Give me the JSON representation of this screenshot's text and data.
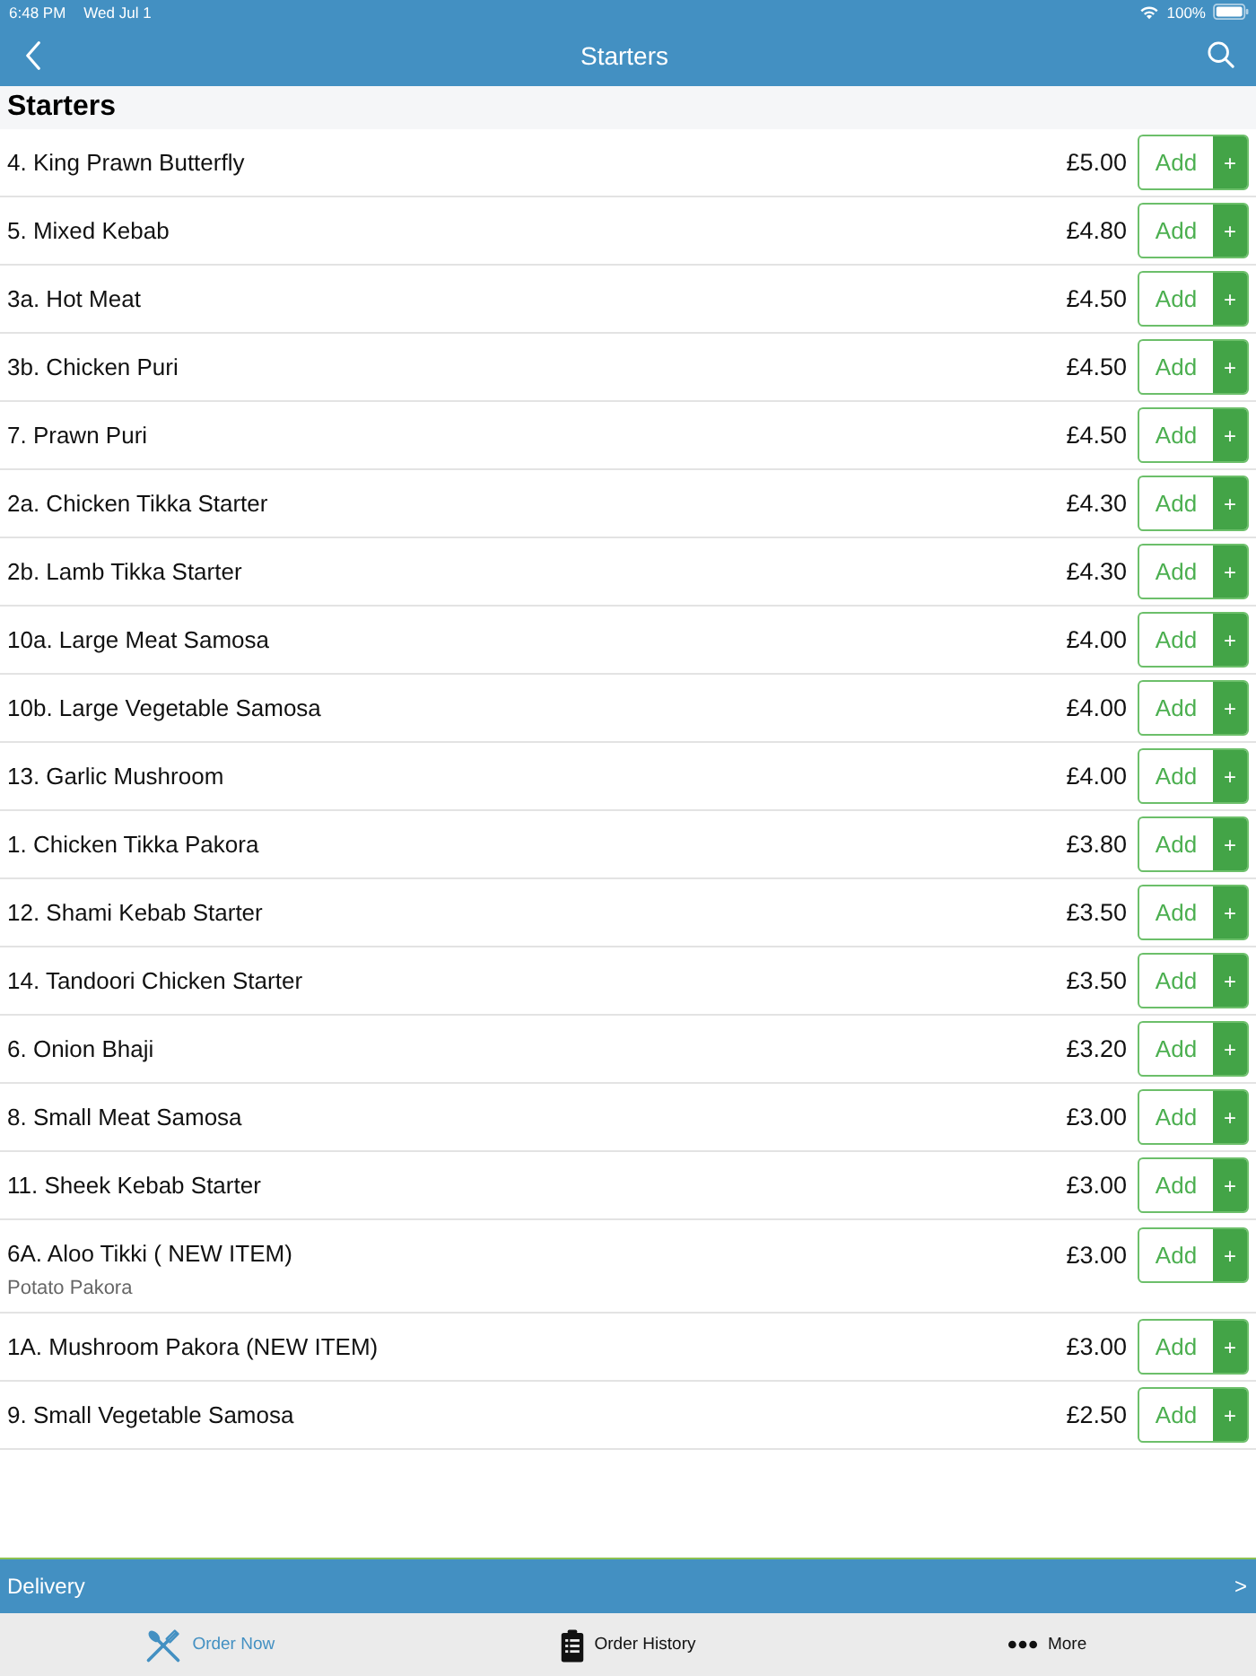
{
  "status_bar": {
    "time": "6:48 PM",
    "date": "Wed Jul 1",
    "battery": "100%"
  },
  "nav": {
    "title": "Starters"
  },
  "section": {
    "title": "Starters"
  },
  "items": [
    {
      "name": "4. King Prawn Butterfly",
      "price": "£5.00",
      "button": "Add",
      "plus": "+"
    },
    {
      "name": "5. Mixed Kebab",
      "price": "£4.80",
      "button": "Add",
      "plus": "+"
    },
    {
      "name": "3a. Hot Meat",
      "price": "£4.50",
      "button": "Add",
      "plus": "+"
    },
    {
      "name": "3b. Chicken Puri",
      "price": "£4.50",
      "button": "Add",
      "plus": "+"
    },
    {
      "name": "7. Prawn Puri",
      "price": "£4.50",
      "button": "Add",
      "plus": "+"
    },
    {
      "name": "2a. Chicken Tikka Starter",
      "price": "£4.30",
      "button": "Add",
      "plus": "+"
    },
    {
      "name": "2b. Lamb Tikka Starter",
      "price": "£4.30",
      "button": "Add",
      "plus": "+"
    },
    {
      "name": "10a. Large Meat Samosa",
      "price": "£4.00",
      "button": "Add",
      "plus": "+"
    },
    {
      "name": "10b. Large Vegetable Samosa",
      "price": "£4.00",
      "button": "Add",
      "plus": "+"
    },
    {
      "name": "13. Garlic Mushroom",
      "price": "£4.00",
      "button": "Add",
      "plus": "+"
    },
    {
      "name": "1. Chicken Tikka Pakora",
      "price": "£3.80",
      "button": "Add",
      "plus": "+"
    },
    {
      "name": "12. Shami Kebab Starter",
      "price": "£3.50",
      "button": "Add",
      "plus": "+"
    },
    {
      "name": "14. Tandoori Chicken Starter",
      "price": "£3.50",
      "button": "Add",
      "plus": "+"
    },
    {
      "name": "6. Onion Bhaji",
      "price": "£3.20",
      "button": "Add",
      "plus": "+"
    },
    {
      "name": "8. Small Meat Samosa",
      "price": "£3.00",
      "button": "Add",
      "plus": "+"
    },
    {
      "name": "11. Sheek Kebab Starter",
      "price": "£3.00",
      "button": "Add",
      "plus": "+"
    },
    {
      "name": "6A. Aloo Tikki ( NEW ITEM)",
      "description": "Potato Pakora",
      "price": "£3.00",
      "button": "Add",
      "plus": "+"
    },
    {
      "name": "1A. Mushroom Pakora (NEW ITEM)",
      "price": "£3.00",
      "button": "Add",
      "plus": "+"
    },
    {
      "name": "9. Small Vegetable Samosa",
      "price": "£2.50",
      "button": "Add",
      "plus": "+"
    }
  ],
  "delivery_bar": {
    "label": "Delivery",
    "arrow": ">"
  },
  "tab_bar": [
    {
      "kind": "cutlery",
      "label": "Order Now",
      "selected": true
    },
    {
      "kind": "clipboard",
      "label": "Order History",
      "selected": false
    },
    {
      "kind": "dots",
      "label": "More",
      "selected": false
    }
  ]
}
